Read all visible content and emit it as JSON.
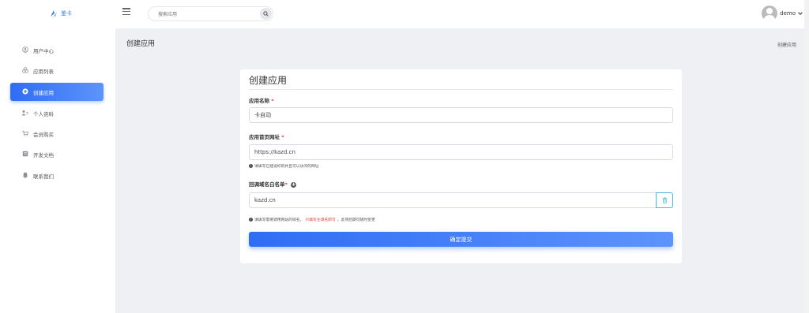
{
  "header": {
    "logo_text": "鉴卡",
    "search_placeholder": "搜索应用",
    "user_name": "demo",
    "caret": "❯"
  },
  "sidebar": {
    "items": [
      {
        "label": "用户中心",
        "icon": "user-circle-icon",
        "active": false
      },
      {
        "label": "应用列表",
        "icon": "apps-icon",
        "active": false
      },
      {
        "label": "创建应用",
        "icon": "plus-circle-icon",
        "active": true
      },
      {
        "label": "个人资料",
        "icon": "profile-icon",
        "active": false
      },
      {
        "label": "会员购买",
        "icon": "cart-icon",
        "active": false
      },
      {
        "label": "开发文档",
        "icon": "document-icon",
        "active": false
      },
      {
        "label": "联系我们",
        "icon": "contact-icon",
        "active": false
      }
    ]
  },
  "main": {
    "page_title": "创建应用",
    "breadcrumb": "创建应用"
  },
  "form": {
    "title": "创建应用",
    "app_name_label": "应用名称",
    "app_name_value": "卡自动",
    "homepage_label": "应用首页网址",
    "homepage_value": "https://kazd.cn",
    "homepage_hint": "请填写已建设好的并且可以访问的网址",
    "whitelist_label": "回调域名白名单",
    "whitelist_value": "kazd.cn",
    "whitelist_hint_pre": "请填写需要调用网站的域名，",
    "whitelist_hint_red": "只填写主域名即可",
    "whitelist_hint_post": "，此项后期可随时变更",
    "required_mark": "*",
    "submit_label": "确定提交"
  },
  "colors": {
    "accent": "#2f6df5",
    "accent_light": "#5d93fb",
    "required": "#e53935",
    "background": "#eef0f4"
  }
}
